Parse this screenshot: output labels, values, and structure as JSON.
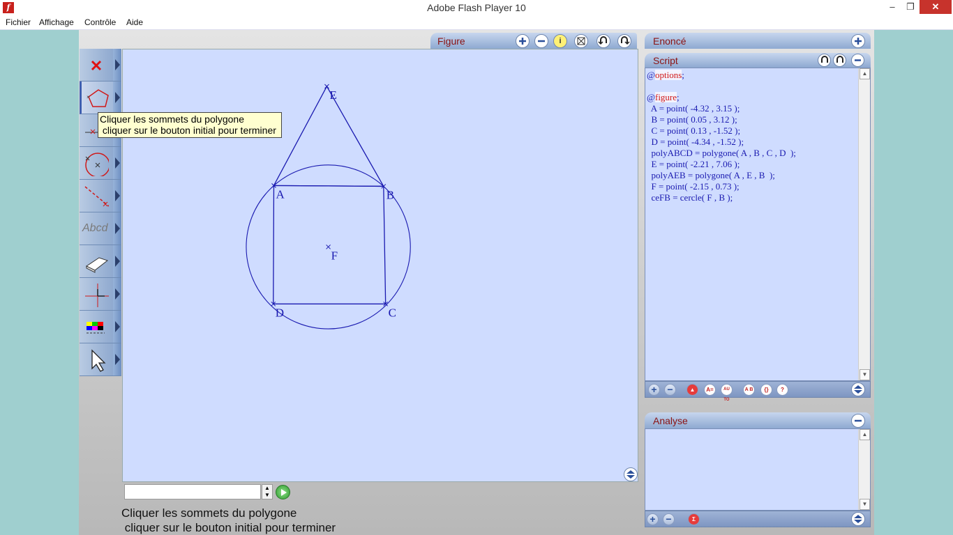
{
  "window": {
    "title": "Adobe Flash Player 10",
    "min_label": "–",
    "max_label": "❐",
    "close_label": "✕"
  },
  "menu": [
    "Fichier",
    "Affichage",
    "Contrôle",
    "Aide"
  ],
  "toolbar": {
    "tools": [
      {
        "icon": "delete-icon"
      },
      {
        "icon": "polygon-icon"
      },
      {
        "icon": "segment-icon"
      },
      {
        "icon": "circle-icon"
      },
      {
        "icon": "line-points-icon"
      },
      {
        "icon": "text-icon",
        "text": "Abcd"
      },
      {
        "icon": "eraser-icon"
      },
      {
        "icon": "axes-icon"
      },
      {
        "icon": "color-palette-icon"
      },
      {
        "icon": "pointer-icon"
      }
    ]
  },
  "tooltip": {
    "text": "Cliquer les sommets du polygone\n cliquer sur le bouton initial pour terminer"
  },
  "figure": {
    "tab_label": "Figure",
    "info_label": "i",
    "points": [
      {
        "name": "A",
        "x": -4.32,
        "y": 3.15
      },
      {
        "name": "B",
        "x": 0.05,
        "y": 3.12
      },
      {
        "name": "C",
        "x": 0.13,
        "y": -1.52
      },
      {
        "name": "D",
        "x": -4.34,
        "y": -1.52
      },
      {
        "name": "E",
        "x": -2.21,
        "y": 7.06
      },
      {
        "name": "F",
        "x": -2.15,
        "y": 0.73
      }
    ]
  },
  "command": {
    "input_value": "",
    "spin_up": "▲",
    "spin_down": "▼"
  },
  "status": {
    "text": "Cliquer les sommets du polygone\n cliquer sur le bouton initial pour terminer"
  },
  "enonce": {
    "label": "Enoncé"
  },
  "script": {
    "label": "Script",
    "lines": [
      "@options;",
      "",
      "@figure;",
      "  A = point( -4.32 , 3.15 );",
      "  B = point( 0.05 , 3.12 );",
      "  C = point( 0.13 , -1.52 );",
      "  D = point( -4.34 , -1.52 );",
      "  polyABCD = polygone( A , B , C , D  );",
      "  E = point( -2.21 , 7.06 );",
      "  polyAEB = polygone( A , E , B  );",
      "  F = point( -2.15 , 0.73 );",
      "  ceFB = cercle( F , B );"
    ],
    "footer_buttons": [
      "+",
      "−",
      "▲",
      "A=",
      "AU TO",
      "A B",
      "{}",
      "?"
    ]
  },
  "analyse": {
    "label": "Analyse",
    "footer_buttons": [
      "+",
      "−",
      "Σ"
    ]
  }
}
